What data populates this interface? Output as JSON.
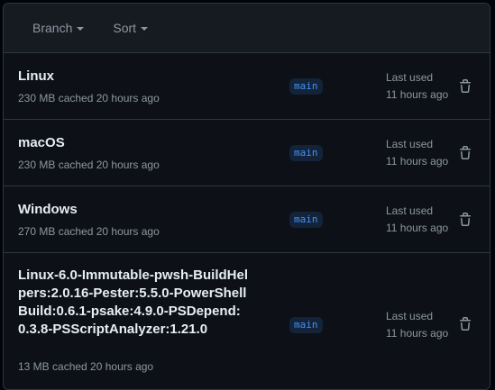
{
  "header": {
    "branch_label": "Branch",
    "sort_label": "Sort"
  },
  "caches": [
    {
      "name": "Linux",
      "size_info": "230 MB cached 20 hours ago",
      "branch": "main",
      "last_used_label": "Last used",
      "last_used_value": "11 hours ago"
    },
    {
      "name": "macOS",
      "size_info": "230 MB cached 20 hours ago",
      "branch": "main",
      "last_used_label": "Last used",
      "last_used_value": "11 hours ago"
    },
    {
      "name": "Windows",
      "size_info": "270 MB cached 20 hours ago",
      "branch": "main",
      "last_used_label": "Last used",
      "last_used_value": "11 hours ago"
    },
    {
      "name": "Linux-6.0-Immutable-pwsh-BuildHelpers:2.0.16-Pester:5.5.0-PowerShellBuild:0.6.1-psake:4.9.0-PSDepend:0.3.8-PSScriptAnalyzer:1.21.0",
      "size_info": "13 MB cached 20 hours ago",
      "branch": "main",
      "last_used_label": "Last used",
      "last_used_value": "11 hours ago"
    }
  ],
  "icons": {
    "delete": "trash-icon",
    "dropdown": "caret-down-icon"
  },
  "colors": {
    "background": "#0d1117",
    "header_bg": "#161b22",
    "border": "#30363d",
    "text_primary": "#e6edf3",
    "text_muted": "#8d96a0",
    "accent": "#4493f8"
  }
}
